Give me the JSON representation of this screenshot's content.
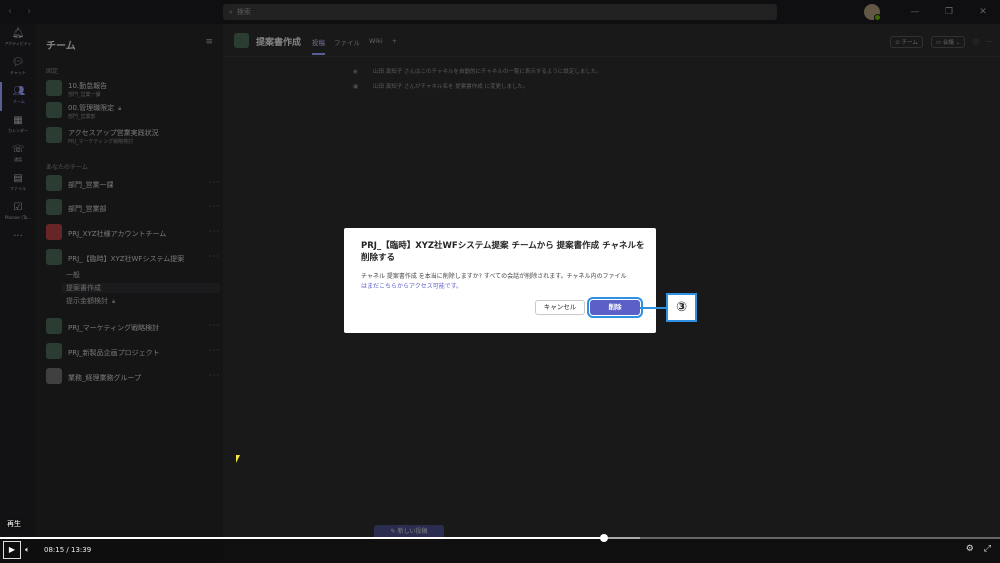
{
  "titlebar": {
    "search_placeholder": "検索"
  },
  "rail": [
    {
      "label": "アクティビティ",
      "icon": "bell-icon"
    },
    {
      "label": "チャット",
      "icon": "chat-icon"
    },
    {
      "label": "チーム",
      "icon": "teams-icon"
    },
    {
      "label": "カレンダー",
      "icon": "calendar-icon"
    },
    {
      "label": "通話",
      "icon": "phone-icon"
    },
    {
      "label": "ファイル",
      "icon": "file-icon"
    },
    {
      "label": "Planner (Ta...",
      "icon": "planner-icon"
    }
  ],
  "sidebar": {
    "title": "チーム",
    "pinned_label": "固定",
    "your_teams_label": "あなたのチーム",
    "pinned": [
      {
        "name": "10.勤怠報告",
        "sub": "部門_営業一課"
      },
      {
        "name": "00.管理職限定",
        "sub": "部門_営業部"
      },
      {
        "name": "アクセスアップ営業実践状況",
        "sub": "PRJ_マーケティング戦略検討"
      }
    ],
    "teams": [
      {
        "name": "部門_営業一課"
      },
      {
        "name": "部門_営業部"
      },
      {
        "name": "PRJ_XYZ社様アカウントチーム"
      },
      {
        "name": "PRJ_【臨時】XYZ社WFシステム提案"
      }
    ],
    "channels": [
      "一般",
      "提案書作成",
      "提示金額検討"
    ],
    "teams_after": [
      {
        "name": "PRJ_マーケティング戦略検討"
      },
      {
        "name": "PRJ_新製品企画プロジェクト"
      },
      {
        "name": "業務_経理業務グループ"
      }
    ]
  },
  "channel": {
    "title": "提案書作成",
    "tabs": [
      "投稿",
      "ファイル",
      "Wiki"
    ],
    "team_button": "チーム",
    "meet_button": "会議",
    "messages": [
      "山田 真知子 さんはこのチャネルを自動的にチャネルの一覧に表示するように設定しました。",
      "山田 真知子 さんがチャネル名を 提案書作成 に変更しました。"
    ],
    "compose": "新しい投稿"
  },
  "dialog": {
    "title": "PRJ_【臨時】XYZ社WFシステム提案 チームから 提案書作成 チャネルを削除する",
    "body_main": "チャネル 提案書作成 を本当に削除しますか? すべての会話が削除されます。チャネル内のファイル",
    "body_link": "はまだこちらからアクセス可能です。",
    "cancel": "キャンセル",
    "delete": "削除"
  },
  "callout": "③",
  "player": {
    "tooltip": "再生",
    "current_time": "08:15",
    "separator": "/",
    "total_time": "13:39",
    "progress": 0.604,
    "buffered": 0.64
  }
}
